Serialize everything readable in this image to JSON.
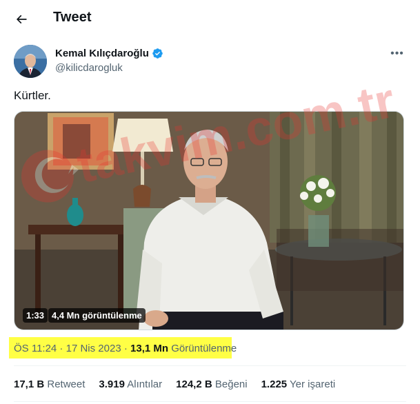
{
  "header": {
    "title": "Tweet"
  },
  "author": {
    "name": "Kemal Kılıçdaroğlu",
    "handle": "@kilicdarogluk"
  },
  "tweet": {
    "text": "Kürtler."
  },
  "media": {
    "duration": "1:33",
    "views": "4,4 Mn görüntülenme"
  },
  "meta": {
    "time": "ÖS 11:24",
    "sep1": " · ",
    "date": "17 Nis 2023",
    "sep2": " · ",
    "views_count": "13,1 Mn",
    "views_label": "Görüntülenme"
  },
  "stats": [
    {
      "value": "17,1 B",
      "label": "Retweet"
    },
    {
      "value": "3.919",
      "label": "Alıntılar"
    },
    {
      "value": "124,2 B",
      "label": "Beğeni"
    },
    {
      "value": "1.225",
      "label": "Yer işareti"
    }
  ],
  "watermark": {
    "text": "takvim.com.tr"
  },
  "colors": {
    "highlight": "#ffff45",
    "verified": "#1d9bf0",
    "secondary_text": "#536471",
    "watermark": "#e8322e"
  }
}
